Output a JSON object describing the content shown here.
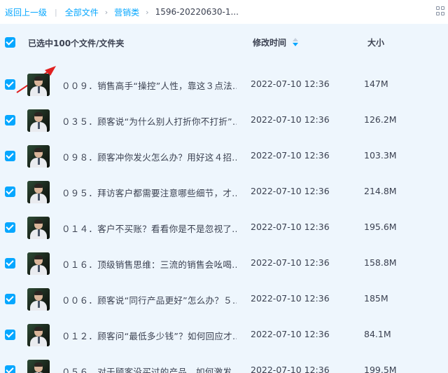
{
  "breadcrumb": {
    "back": "返回上一级",
    "separator": "|",
    "all_files": "全部文件",
    "chevron": "›",
    "folder": "营销类",
    "current": "1596-20220630-1..."
  },
  "header": {
    "selected_text": "已选中100个文件/文件夹",
    "col_mtime": "修改时间",
    "col_size": "大小"
  },
  "colors": {
    "accent": "#06a7ff",
    "list_background": "#eef6fd",
    "annotation_arrow": "#e02020"
  },
  "files": [
    {
      "name": "００９．销售高手“操控”人性，靠这３点法...",
      "mtime": "2022-07-10 12:36",
      "size": "147M"
    },
    {
      "name": "０３５．顾客说“为什么别人打折你不打折”...",
      "mtime": "2022-07-10 12:36",
      "size": "126.2M"
    },
    {
      "name": "０９８．顾客冲你发火怎么办？用好这４招...",
      "mtime": "2022-07-10 12:36",
      "size": "103.3M"
    },
    {
      "name": "０９５．拜访客户都需要注意哪些细节，才...",
      "mtime": "2022-07-10 12:36",
      "size": "214.8M"
    },
    {
      "name": "０１４．客户不买账？看看你是不是忽视了...",
      "mtime": "2022-07-10 12:36",
      "size": "195.6M"
    },
    {
      "name": "０１６．顶级销售思维：三流的销售会吆喝...",
      "mtime": "2022-07-10 12:36",
      "size": "158.8M"
    },
    {
      "name": "００６．顾客说“同行产品更好”怎么办？５...",
      "mtime": "2022-07-10 12:36",
      "size": "185M"
    },
    {
      "name": "０１２．顾客问“最低多少钱”？如何回应才...",
      "mtime": "2022-07-10 12:36",
      "size": "84.1M"
    },
    {
      "name": "０５６．对于顾客没买过的产品，如何激发...",
      "mtime": "2022-07-10 12:36",
      "size": "199.5M"
    }
  ]
}
